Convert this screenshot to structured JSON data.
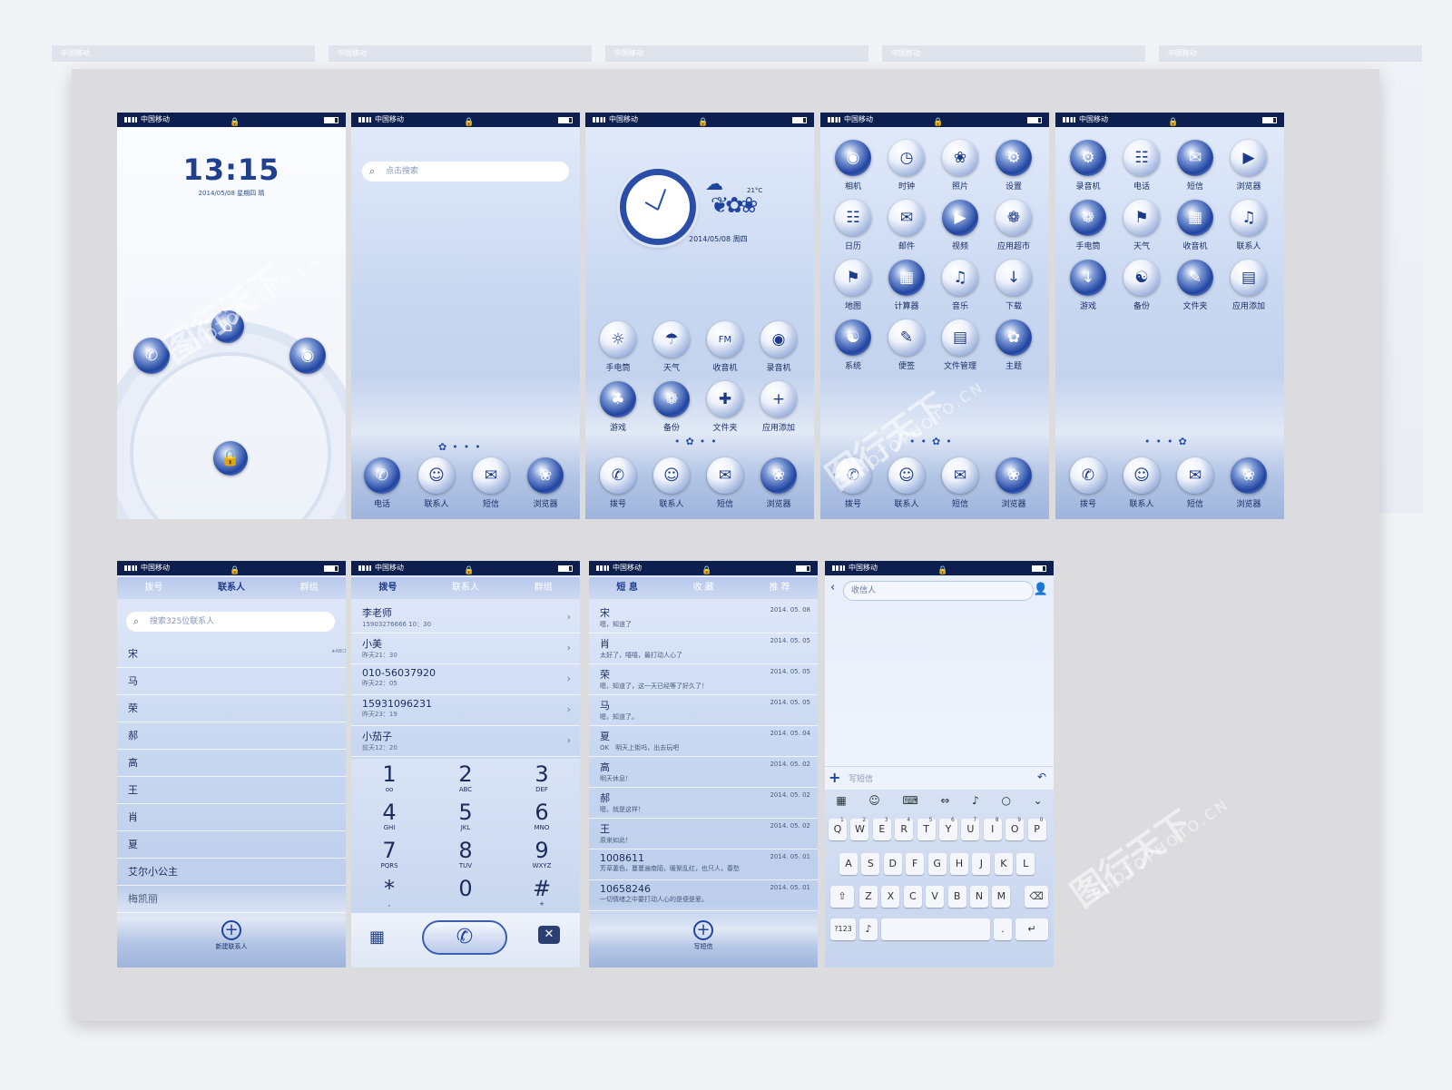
{
  "status": {
    "carrier": "中国移动"
  },
  "lock": {
    "time": "13:15",
    "date": "2014/05/08 星期四 晴"
  },
  "home1": {
    "search_placeholder": "点击搜索"
  },
  "dock_labels_a": [
    "电话",
    "联系人",
    "短信",
    "浏览器"
  ],
  "dock_labels_b": [
    "拨号",
    "联系人",
    "短信",
    "浏览器"
  ],
  "clock_widget": {
    "date": "2014/05/08 周四",
    "temp": "21°C"
  },
  "home2_icons": [
    "手电筒",
    "天气",
    "收音机",
    "录音机",
    "游戏",
    "备份",
    "文件夹",
    "应用添加"
  ],
  "drawer_icons": [
    "相机",
    "时钟",
    "照片",
    "设置",
    "日历",
    "邮件",
    "视频",
    "应用超市",
    "地图",
    "计算器",
    "音乐",
    "下载",
    "系统",
    "便签",
    "文件管理",
    "主题"
  ],
  "drawer2_icons": [
    "录音机",
    "电话",
    "短信",
    "浏览器",
    "手电筒",
    "天气",
    "收音机",
    "联系人",
    "游戏",
    "备份",
    "文件夹",
    "应用添加"
  ],
  "contacts": {
    "tabs": [
      "拨号",
      "联系人",
      "群组"
    ],
    "search_placeholder": "搜索325位联系人",
    "names": [
      "宋",
      "马",
      "荣",
      "郝",
      "高",
      "王",
      "肖",
      "夏",
      "艾尔小公主",
      "梅凯丽"
    ],
    "new_contact": "新建联系人"
  },
  "dialer": {
    "tabs": [
      "拨号",
      "联系人",
      "群组"
    ],
    "calls": [
      {
        "name": "李老师",
        "detail": "15903276666 10：30"
      },
      {
        "name": "小美",
        "detail": "昨天21：30"
      },
      {
        "name": "010-56037920",
        "detail": "昨天22：05"
      },
      {
        "name": "15931096231",
        "detail": "昨天23：19"
      },
      {
        "name": "小茄子",
        "detail": "前天12：20"
      }
    ],
    "keys": [
      {
        "n": "1",
        "s": "oo"
      },
      {
        "n": "2",
        "s": "ABC"
      },
      {
        "n": "3",
        "s": "DEF"
      },
      {
        "n": "4",
        "s": "GHI"
      },
      {
        "n": "5",
        "s": "JKL"
      },
      {
        "n": "6",
        "s": "MNO"
      },
      {
        "n": "7",
        "s": "PQRS"
      },
      {
        "n": "8",
        "s": "TUV"
      },
      {
        "n": "9",
        "s": "WXYZ"
      },
      {
        "n": "*",
        "s": ","
      },
      {
        "n": "0",
        "s": ""
      },
      {
        "n": "#",
        "s": "+"
      }
    ]
  },
  "messages": {
    "tabs": [
      "短 息",
      "收 藏",
      "推 荐"
    ],
    "items": [
      {
        "from": "宋",
        "preview": "嗯，知道了",
        "date": "2014. 05. 08"
      },
      {
        "from": "肖",
        "preview": "太好了，嘻嘻，最打动人心了",
        "date": "2014. 05. 05"
      },
      {
        "from": "荣",
        "preview": "嗯，知道了，这一天已经等了好久了！",
        "date": "2014. 05. 05"
      },
      {
        "from": "马",
        "preview": "嗯，知道了。",
        "date": "2014. 05. 05"
      },
      {
        "from": "夏",
        "preview": "OK　明天上街吗，出去玩吧",
        "date": "2014. 05. 04"
      },
      {
        "from": "高",
        "preview": "明天休息！",
        "date": "2014. 05. 02"
      },
      {
        "from": "郝",
        "preview": "嗯，就是这样！",
        "date": "2014. 05. 02"
      },
      {
        "from": "王",
        "preview": "原来如此！",
        "date": "2014. 05. 02"
      },
      {
        "from": "1008611",
        "preview": "芳草萋色，蔓蔓遍南陌，暖絮乱红，也只人，春愁",
        "date": "2014. 05. 01"
      },
      {
        "from": "10658246",
        "preview": "一切情绪之中要打动人心的是便是爱。",
        "date": "2014. 05. 01"
      }
    ],
    "compose": "写短信"
  },
  "compose": {
    "recipient_placeholder": "收信人",
    "input_placeholder": "写短信",
    "row1": [
      "Q",
      "W",
      "E",
      "R",
      "T",
      "Y",
      "U",
      "I",
      "O",
      "P"
    ],
    "row1_nums": [
      "1",
      "2",
      "3",
      "4",
      "5",
      "6",
      "7",
      "8",
      "9",
      "0"
    ],
    "row2": [
      "A",
      "S",
      "D",
      "F",
      "G",
      "H",
      "J",
      "K",
      "L"
    ],
    "row3": [
      "Z",
      "X",
      "C",
      "V",
      "B",
      "N",
      "M"
    ],
    "sym_key": "?123",
    "period_key": "."
  },
  "watermark": {
    "cn": "图行天下",
    "en": "PHOTOPHOTO.CN"
  }
}
